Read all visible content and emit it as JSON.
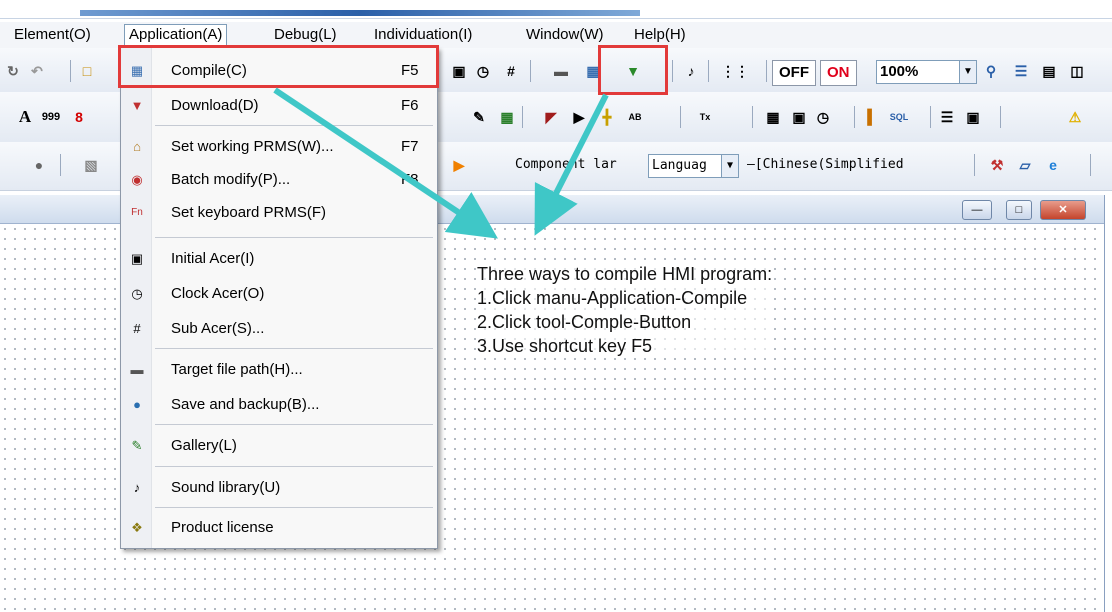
{
  "menubar": {
    "items": [
      {
        "label": "Element(O)"
      },
      {
        "label": "Application(A)"
      },
      {
        "label": "Debug(L)"
      },
      {
        "label": "Individuation(I)"
      },
      {
        "label": "Window(W)"
      },
      {
        "label": "Help(H)"
      }
    ]
  },
  "toolbar": {
    "off_label": "OFF",
    "on_label": "ON",
    "zoom_value": "100%",
    "component_label": "Component lar",
    "language_value": "Languag",
    "language_text": "–[Chinese(Simplified"
  },
  "application_menu": {
    "items": [
      {
        "label": "Compile(C)",
        "shortcut": "F5",
        "icon": "compile-icon"
      },
      {
        "label": "Download(D)",
        "shortcut": "F6",
        "icon": "download-icon"
      },
      {
        "label": "Set working PRMS(W)...",
        "shortcut": "F7",
        "icon": "house-icon"
      },
      {
        "label": "Batch modify(P)...",
        "shortcut": "F8",
        "icon": "batch-icon"
      },
      {
        "label": "Set keyboard PRMS(F)",
        "shortcut": "",
        "icon": "keyboard-icon"
      },
      {
        "label": "Initial Acer(I)",
        "shortcut": "",
        "icon": "initial-icon"
      },
      {
        "label": "Clock Acer(O)",
        "shortcut": "",
        "icon": "clock-icon"
      },
      {
        "label": "Sub Acer(S)...",
        "shortcut": "",
        "icon": "sub-icon"
      },
      {
        "label": "Target file path(H)...",
        "shortcut": "",
        "icon": "drive-icon"
      },
      {
        "label": "Save and backup(B)...",
        "shortcut": "",
        "icon": "backup-icon"
      },
      {
        "label": "Gallery(L)",
        "shortcut": "",
        "icon": "gallery-icon"
      },
      {
        "label": "Sound library(U)",
        "shortcut": "",
        "icon": "music-note-icon"
      },
      {
        "label": "Product license",
        "shortcut": "",
        "icon": "license-icon"
      }
    ]
  },
  "note": {
    "line1": "Three ways to compile HMI program:",
    "line2": "1.Click manu-Application-Compile",
    "line3": "2.Click tool-Comple-Button",
    "line4": "3.Use shortcut key F5"
  },
  "colors": {
    "highlight": "#e23a3a",
    "arrow": "#3fc7c7",
    "on_text": "#e0001b"
  }
}
